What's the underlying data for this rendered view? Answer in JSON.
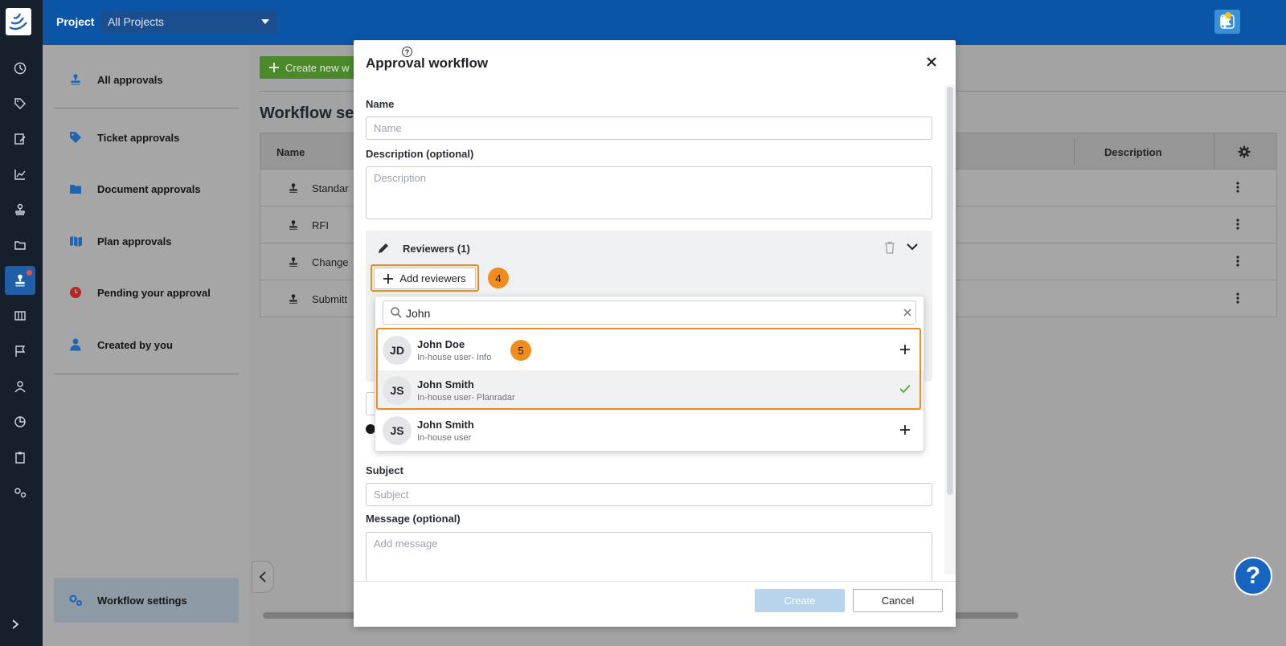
{
  "colors": {
    "topbar": "#0b55a6",
    "rail": "#16202c",
    "accent_orange": "#f08c1b",
    "primary_blue": "#1765c0",
    "green": "#4a8a2b",
    "check_green": "#52a33a"
  },
  "topbar": {
    "project_label": "Project",
    "project_select": "All Projects"
  },
  "sidemenu": {
    "items": [
      {
        "label": "All approvals",
        "icon": "stamp-icon"
      },
      {
        "label": "Ticket approvals",
        "icon": "tag-icon"
      },
      {
        "label": "Document approvals",
        "icon": "folder-icon"
      },
      {
        "label": "Plan approvals",
        "icon": "map-icon"
      },
      {
        "label": "Pending your approval",
        "icon": "clock-icon"
      },
      {
        "label": "Created by you",
        "icon": "person-icon"
      }
    ],
    "workflow_settings": "Workflow settings"
  },
  "main": {
    "create_button": "Create new w",
    "title": "Workflow se",
    "table": {
      "headers": {
        "name": "Name",
        "description": "Description"
      },
      "rows": [
        "Standar",
        "RFI",
        "Change",
        "Submitt"
      ]
    }
  },
  "modal": {
    "title": "Approval workflow",
    "help": "?",
    "name_label": "Name",
    "name_placeholder": "Name",
    "description_label": "Description (optional)",
    "description_placeholder": "Description",
    "reviewers_header": "Reviewers (1)",
    "add_reviewers": "Add reviewers",
    "badge_4": "4",
    "badge_5": "5",
    "search_value": "John",
    "results": [
      {
        "initials": "JD",
        "name": "John Doe",
        "sub": "In-house user- Info",
        "state": "add"
      },
      {
        "initials": "JS",
        "name": "John Smith",
        "sub": "In-house user- Planradar",
        "state": "selected"
      },
      {
        "initials": "JS",
        "name": "John Smith",
        "sub": "In-house user",
        "state": "add"
      }
    ],
    "subject_label": "Subject",
    "subject_placeholder": "Subject",
    "message_label": "Message (optional)",
    "message_placeholder": "Add message",
    "create_button": "Create",
    "cancel_button": "Cancel"
  },
  "help_button": "?"
}
